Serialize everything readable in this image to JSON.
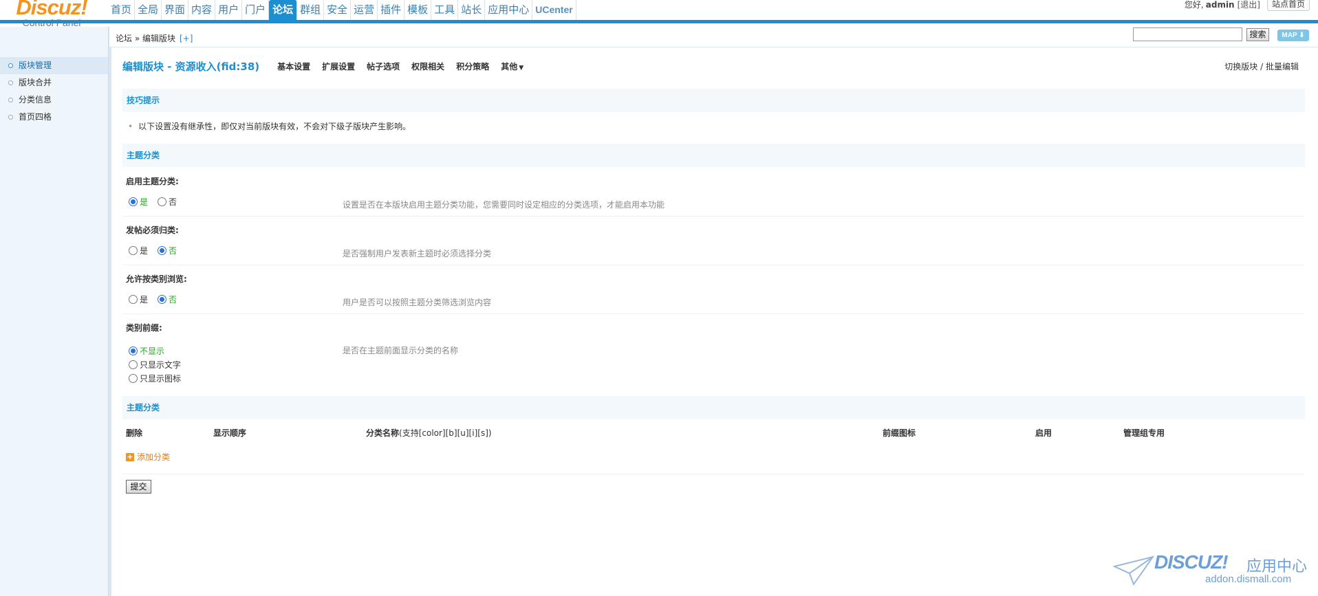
{
  "header": {
    "logo_brand": "Discuz",
    "logo_bang": "!",
    "logo_sub": "Control Panel",
    "nav": [
      "首页",
      "全局",
      "界面",
      "内容",
      "用户",
      "门户",
      "论坛",
      "群组",
      "安全",
      "运营",
      "插件",
      "模板",
      "工具",
      "站长",
      "应用中心",
      "UCenter"
    ],
    "active_nav": "论坛",
    "user": {
      "greeting": "您好,",
      "username": "admin",
      "logout": "[退出]",
      "site_home": "站点首页"
    }
  },
  "sidebar": {
    "items": [
      {
        "label": "版块管理",
        "active": true
      },
      {
        "label": "版块合并",
        "active": false
      },
      {
        "label": "分类信息",
        "active": false
      },
      {
        "label": "首页四格",
        "active": false
      }
    ]
  },
  "breadcrumb": {
    "text": "论坛 » 编辑版块",
    "plus": "[+]"
  },
  "search": {
    "value": "",
    "button": "搜索",
    "map": "MAP ⬇"
  },
  "page": {
    "title": "编辑版块 - 资源收入(fid:38)",
    "tabs": [
      "基本设置",
      "扩展设置",
      "帖子选项",
      "权限相关",
      "积分策略",
      "其他"
    ],
    "more_caret": "▼",
    "actions": {
      "switch": "切换版块",
      "separator": " / ",
      "batch": "批量编辑"
    }
  },
  "tips": {
    "heading": "技巧提示",
    "bullet": "•",
    "text": "以下设置没有继承性，即仅对当前版块有效，不会对下级子版块产生影响。"
  },
  "section1": {
    "heading": "主题分类",
    "fields": [
      {
        "label": "启用主题分类:",
        "options": [
          {
            "label": "是",
            "checked": true
          },
          {
            "label": "否",
            "checked": false
          }
        ],
        "desc": "设置是否在本版块启用主题分类功能，您需要同时设定相应的分类选项，才能启用本功能"
      },
      {
        "label": "发帖必须归类:",
        "options": [
          {
            "label": "是",
            "checked": false
          },
          {
            "label": "否",
            "checked": true
          }
        ],
        "desc": "是否强制用户发表新主题时必须选择分类"
      },
      {
        "label": "允许按类别浏览:",
        "options": [
          {
            "label": "是",
            "checked": false
          },
          {
            "label": "否",
            "checked": true
          }
        ],
        "desc": "用户是否可以按照主题分类筛选浏览内容"
      },
      {
        "label": "类别前缀:",
        "options": [
          {
            "label": "不显示",
            "checked": true
          },
          {
            "label": "只显示文字",
            "checked": false
          },
          {
            "label": "只显示图标",
            "checked": false
          }
        ],
        "desc": "是否在主题前面显示分类的名称"
      }
    ]
  },
  "section2": {
    "heading": "主题分类",
    "columns": {
      "delete": "删除",
      "order": "显示顺序",
      "name": "分类名称",
      "name_hint": "(支持[color][b][u][i][s])",
      "icon": "前缀图标",
      "enabled": "启用",
      "admin_only": "管理组专用"
    },
    "add_label": "添加分类",
    "submit": "提交"
  },
  "watermark": {
    "brand": "DISCUZ!",
    "cn": "应用中心",
    "url": "addon.dismall.com"
  },
  "colors": {
    "accent": "#1d8fd1",
    "logo": "#f39320",
    "checked_label": "#22aa22",
    "add_link": "#f07a10"
  }
}
